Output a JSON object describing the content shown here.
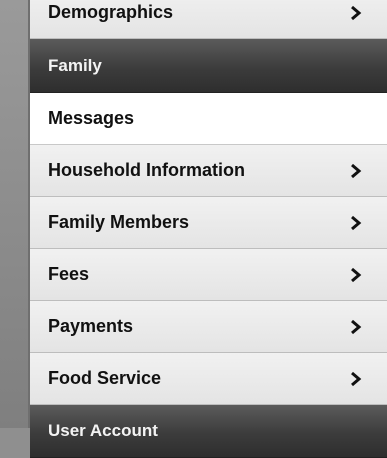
{
  "menu": {
    "items": [
      {
        "label": "Demographics",
        "type": "item",
        "chevron": true
      },
      {
        "label": "Family",
        "type": "header",
        "chevron": false
      },
      {
        "label": "Messages",
        "type": "active",
        "chevron": false
      },
      {
        "label": "Household Information",
        "type": "item",
        "chevron": true
      },
      {
        "label": "Family Members",
        "type": "item",
        "chevron": true
      },
      {
        "label": "Fees",
        "type": "item",
        "chevron": true
      },
      {
        "label": "Payments",
        "type": "item",
        "chevron": true
      },
      {
        "label": "Food Service",
        "type": "item",
        "chevron": true
      },
      {
        "label": "User Account",
        "type": "header",
        "chevron": false
      }
    ]
  },
  "colors": {
    "header_bg": "#3c3c3c",
    "item_bg": "#e8e8e8",
    "active_bg": "#ffffff",
    "accent": "#e02020"
  },
  "icons": {
    "chevron": "chevron-right-icon"
  }
}
